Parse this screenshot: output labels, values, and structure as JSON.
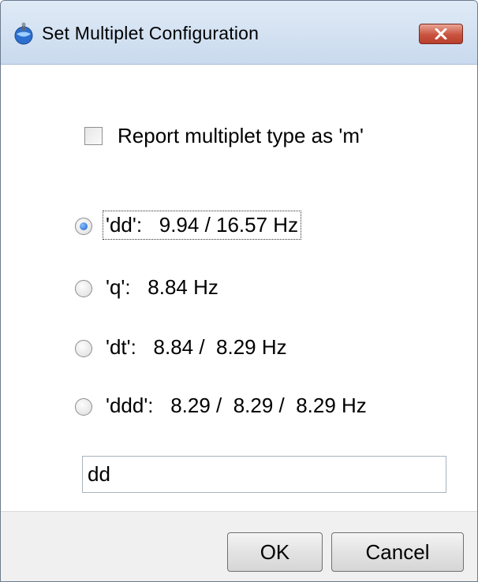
{
  "window": {
    "title": "Set Multiplet Configuration"
  },
  "options": {
    "report_m_label": "Report multiplet type as 'm'",
    "report_m_checked": false
  },
  "multiplets": [
    {
      "label": "'dd':   9.94 / 16.57 Hz",
      "selected": true
    },
    {
      "label": "'q':   8.84 Hz",
      "selected": false
    },
    {
      "label": "'dt':   8.84 /  8.29 Hz",
      "selected": false
    },
    {
      "label": "'ddd':   8.29 /  8.29 /  8.29 Hz",
      "selected": false
    }
  ],
  "multiplet_field": {
    "value": "dd"
  },
  "buttons": {
    "ok": "OK",
    "cancel": "Cancel"
  },
  "icons": {
    "app": "app-icon",
    "close": "close-icon"
  },
  "colors": {
    "close_button": "#c9533f",
    "radio_selected": "#1a5fc5"
  }
}
